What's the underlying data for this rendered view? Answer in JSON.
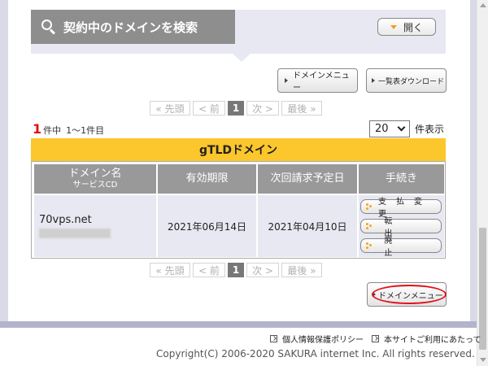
{
  "search": {
    "title": "契約中のドメインを検索",
    "open_label": "開く"
  },
  "top_buttons": {
    "domain_menu": "ドメインメニュー",
    "download": "一覧表ダウンロード"
  },
  "pagination": {
    "first": "« 先頭",
    "prev": "< 前",
    "current": "1",
    "next": "次 >",
    "last": "最後 »"
  },
  "summary": {
    "count": "1",
    "count_suffix": "件中",
    "range": "1～1件目"
  },
  "per_page": {
    "value": "20",
    "suffix": "件表示"
  },
  "table": {
    "title": "gTLDドメイン",
    "headers": {
      "name": "ドメイン名",
      "name_sub": "サービスCD",
      "expiry": "有効期限",
      "billing": "次回請求予定日",
      "procedure": "手続き"
    },
    "rows": [
      {
        "domain": "70vps.net",
        "expiry": "2021年06月14日",
        "billing": "2021年04月10日",
        "actions": [
          "支払変更",
          "転出",
          "廃止"
        ]
      }
    ]
  },
  "bottom_button": {
    "domain_menu": "ドメインメニュー"
  },
  "footer": {
    "privacy": "個人情報保護ポリシー",
    "terms": "本サイトご利用にあたって",
    "copyright": "Copyright(C) 2006-2020 SAKURA internet Inc. All rights reserved."
  },
  "colors": {
    "accent": "#fcc62d",
    "header_gray": "#8e8e8e",
    "highlight": "#e0101a"
  }
}
